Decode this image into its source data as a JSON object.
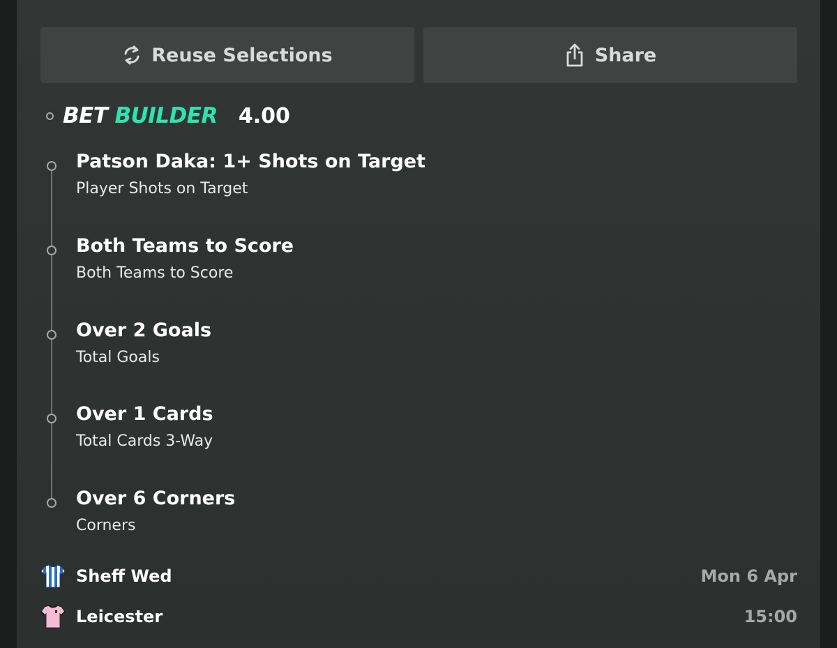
{
  "actions": {
    "reuse_label": "Reuse Selections",
    "share_label": "Share",
    "reuse_icon": "refresh-icon",
    "share_icon": "share-icon"
  },
  "bet_builder": {
    "label_bet": "BET",
    "label_builder": "BUILDER",
    "odds": "4.00",
    "accent_color": "#30e3ae"
  },
  "selections": [
    {
      "title": "Patson Daka: 1+ Shots on Target",
      "market": "Player Shots on Target"
    },
    {
      "title": "Both Teams to Score",
      "market": "Both Teams to Score"
    },
    {
      "title": "Over 2 Goals",
      "market": "Total Goals"
    },
    {
      "title": "Over 1 Cards",
      "market": "Total Cards 3-Way"
    },
    {
      "title": "Over 6 Corners",
      "market": "Corners"
    }
  ],
  "match": {
    "home_team": "Sheff Wed",
    "away_team": "Leicester",
    "date": "Mon 6 Apr",
    "time": "15:00",
    "home_kit_icon": "striped-shirt-icon",
    "away_kit_icon": "pink-shirt-icon"
  }
}
